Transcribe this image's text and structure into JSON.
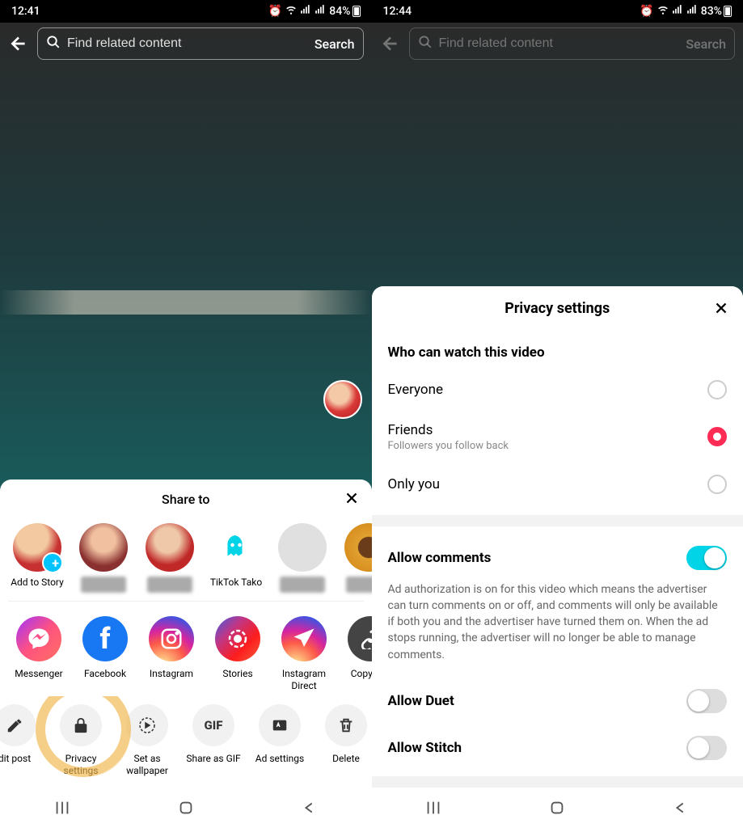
{
  "left": {
    "status": {
      "time": "12:41",
      "battery": "84%"
    },
    "search": {
      "placeholder": "Find related content",
      "button": "Search"
    },
    "share_sheet": {
      "title": "Share to",
      "contacts": [
        {
          "label": "Add to Story",
          "av": "a1 story"
        },
        {
          "label": "",
          "av": "a2",
          "blur": true
        },
        {
          "label": "",
          "av": "a3",
          "blur": true
        },
        {
          "label": "TikTok Tako",
          "av": "a4 ghost"
        },
        {
          "label": "",
          "av": "a5",
          "blur": true
        },
        {
          "label": "",
          "av": "a6",
          "blur": true
        }
      ],
      "apps": [
        {
          "label": "Messenger",
          "cls": "msgr"
        },
        {
          "label": "Facebook",
          "cls": "fb"
        },
        {
          "label": "Instagram",
          "cls": "ig"
        },
        {
          "label": "Stories",
          "cls": "st"
        },
        {
          "label": "Instagram Direct",
          "cls": "igd"
        },
        {
          "label": "Copy link",
          "cls": "copy"
        }
      ],
      "actions": [
        {
          "label": "dit post",
          "icon": "pencil"
        },
        {
          "label": "Privacy settings",
          "icon": "lock"
        },
        {
          "label": "Set as wallpaper",
          "icon": "live"
        },
        {
          "label": "Share as GIF",
          "icon": "gif"
        },
        {
          "label": "Ad settings",
          "icon": "ad"
        },
        {
          "label": "Delete",
          "icon": "trash"
        }
      ]
    }
  },
  "right": {
    "status": {
      "time": "12:44",
      "battery": "83%"
    },
    "search": {
      "placeholder": "Find related content",
      "button": "Search"
    },
    "privacy": {
      "title": "Privacy settings",
      "who_title": "Who can watch this video",
      "options": [
        {
          "label": "Everyone",
          "sub": "",
          "selected": false
        },
        {
          "label": "Friends",
          "sub": "Followers you follow back",
          "selected": true
        },
        {
          "label": "Only you",
          "sub": "",
          "selected": false
        }
      ],
      "allow_comments": {
        "label": "Allow comments",
        "on": true,
        "desc": "Ad authorization is on for this video which means the advertiser can turn comments on or off, and comments will only be available if both you and the advertiser have turned them on. When the ad stops running, the advertiser will no longer be able to manage comments."
      },
      "allow_duet": {
        "label": "Allow Duet",
        "on": false
      },
      "allow_stitch": {
        "label": "Allow Stitch",
        "on": false
      }
    }
  }
}
